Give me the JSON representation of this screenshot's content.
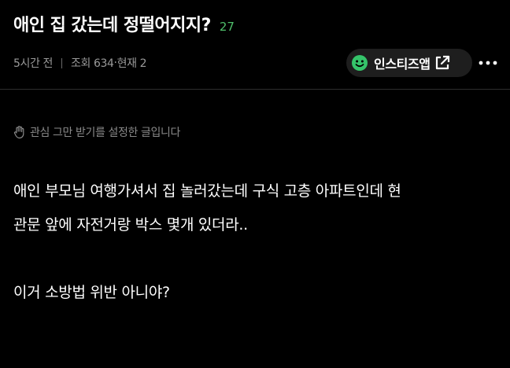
{
  "post": {
    "title": "애인 집 갔는데 정떨어지지?",
    "comment_count": "27",
    "meta": {
      "time_ago": "5시간 전",
      "views": "조회 634",
      "current": "현재 2"
    },
    "app_button_label": "인스티즈앱",
    "notice": "관심 그만 받기를 설정한 글입니다",
    "body": {
      "line1": "애인 부모님 여행가셔서 집 놀러갔는데 구식 고층 아파트인데 현",
      "line2": "관문 앞에 자전거랑 박스 몇개 있더라..",
      "line3": "이거 소방법 위반 아니야?"
    }
  },
  "icons": {
    "app_logo": "smile-icon",
    "open_external": "external-link-icon",
    "more": "more-dots-icon",
    "notice": "hand-stop-icon"
  },
  "colors": {
    "background": "#000000",
    "comment_count": "#4fbf6b",
    "app_logo": "#35c46a",
    "meta_text": "#9a9a9a",
    "button_bg": "#1e1e1e"
  }
}
